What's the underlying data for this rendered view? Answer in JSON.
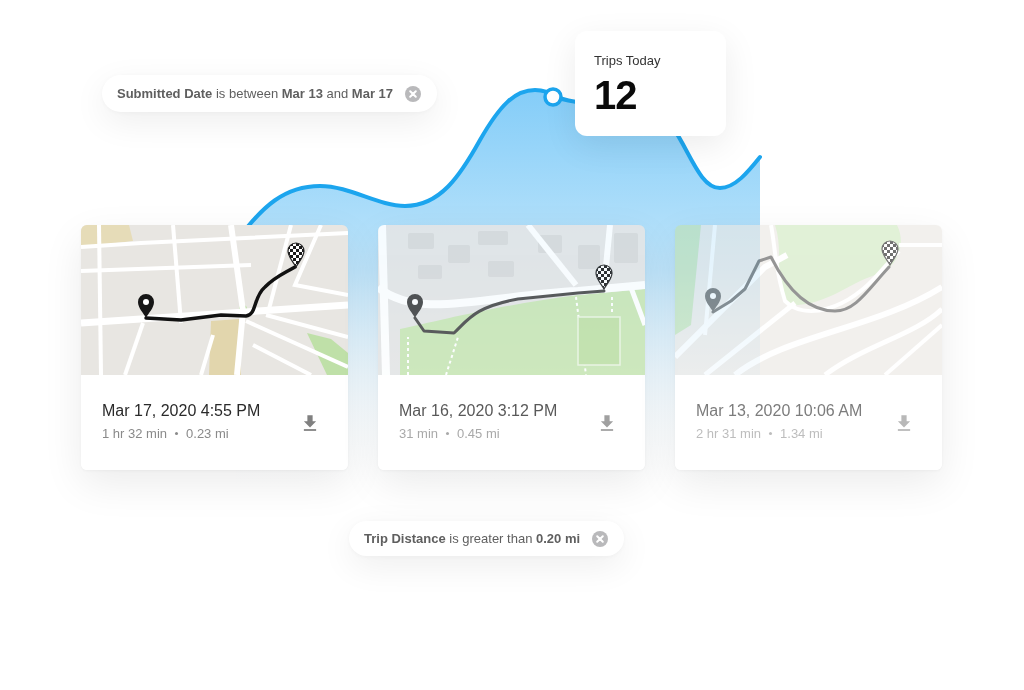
{
  "date_filter": {
    "text": "**Submitted Date** is between **Mar 13** and **Mar 17**"
  },
  "stat_card": {
    "label": "Trips Today",
    "value": "12"
  },
  "trips": [
    {
      "date": "Mar 17, 2020 4:55 PM",
      "duration": "1 hr 32 min",
      "distance": "0.23 mi",
      "kind": "strong"
    },
    {
      "date": "Mar 16, 2020 3:12 PM",
      "duration": "31 min",
      "distance": "0.45 mi",
      "kind": "medium"
    },
    {
      "date": "Mar 13, 2020 10:06 AM",
      "duration": "2 hr 31 min",
      "distance": "1.34 mi",
      "kind": "faint"
    }
  ],
  "distance_filter": {
    "text": "**Trip Distance** is greater than **0.20 mi**"
  }
}
